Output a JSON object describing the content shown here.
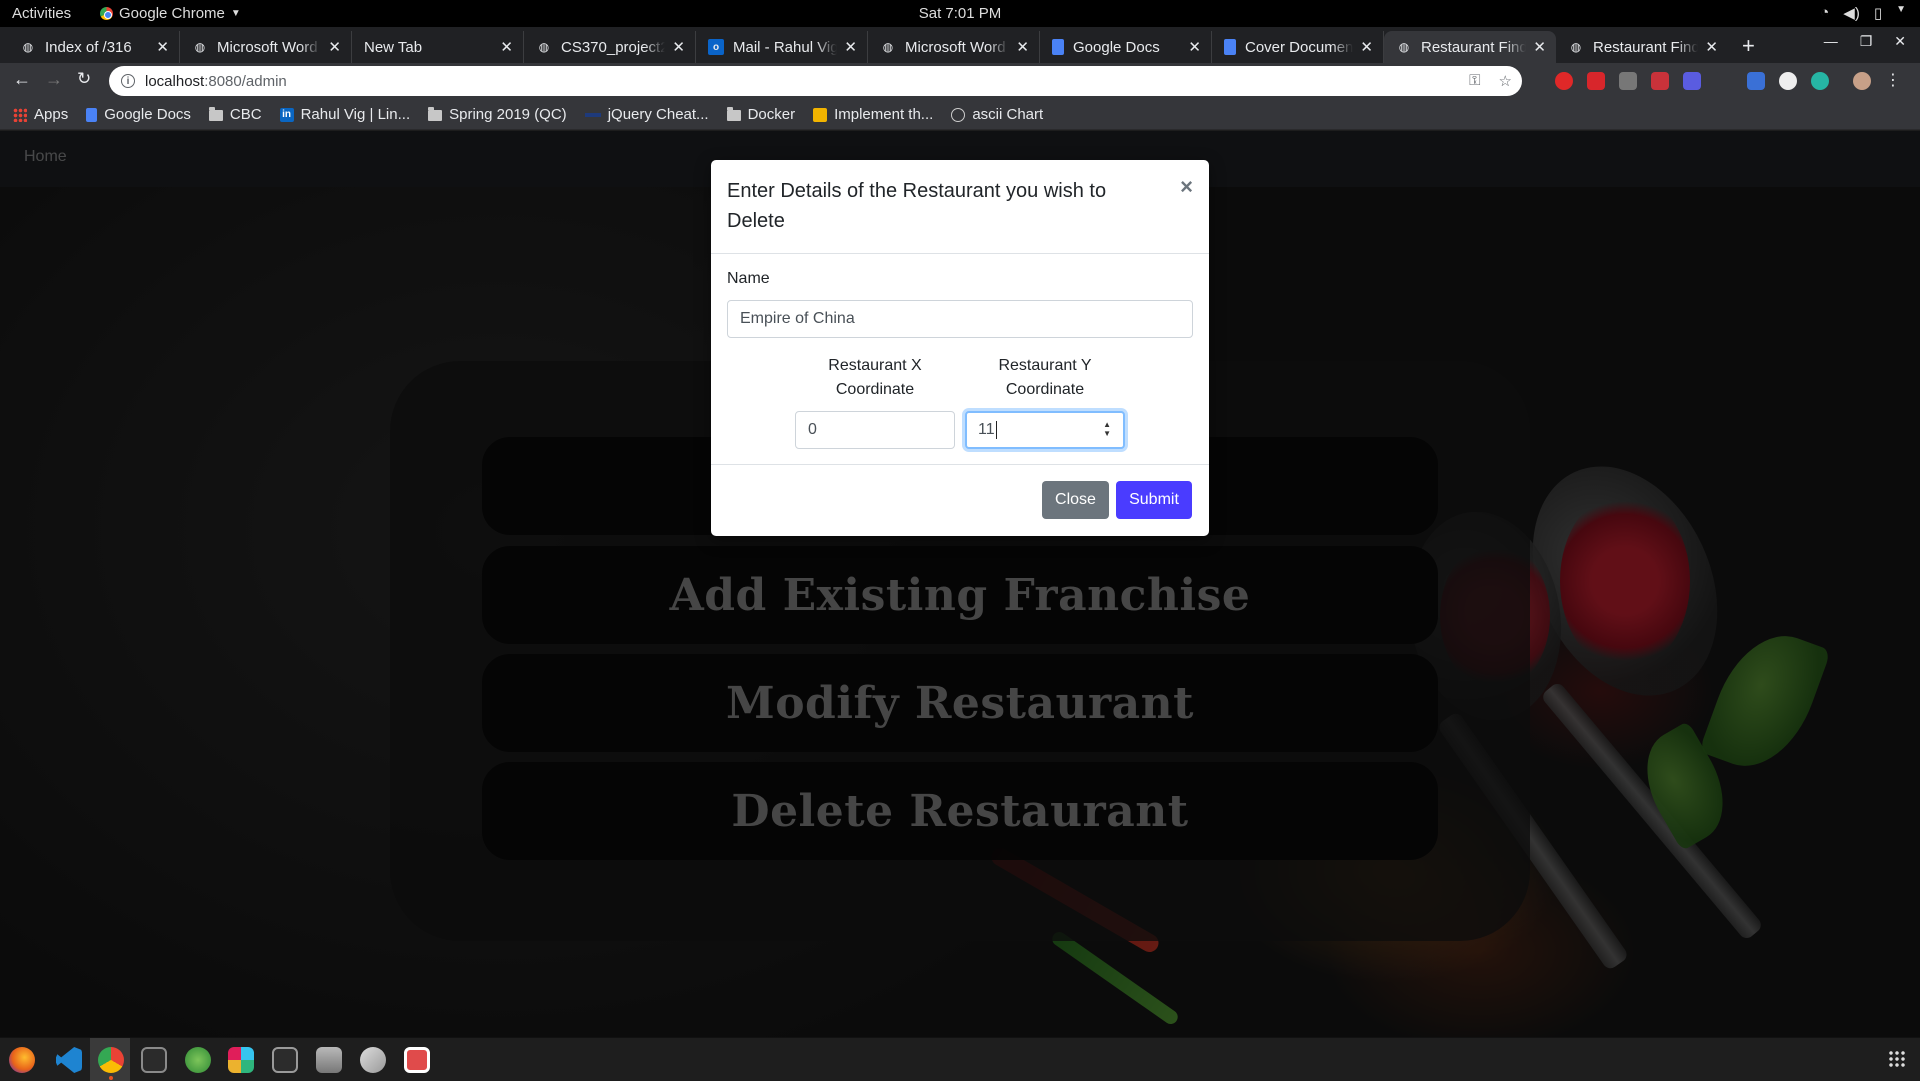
{
  "system_bar": {
    "activities": "Activities",
    "app_name": "Google Chrome",
    "clock": "Sat  7:01 PM"
  },
  "tabs": [
    {
      "title": "Index of /316",
      "active": false
    },
    {
      "title": "Microsoft Word",
      "active": false
    },
    {
      "title": "New Tab",
      "active": false
    },
    {
      "title": "CS370_project2",
      "active": false
    },
    {
      "title": "Mail - Rahul Vig",
      "active": false
    },
    {
      "title": "Microsoft Word",
      "active": false
    },
    {
      "title": "Google Docs",
      "active": false
    },
    {
      "title": "Cover Documen",
      "active": false
    },
    {
      "title": "Restaurant Find",
      "active": true
    },
    {
      "title": "Restaurant Find",
      "active": false
    }
  ],
  "address_bar": {
    "host": "localhost",
    "path": ":8080/admin"
  },
  "bookmarks": [
    {
      "label": "Apps",
      "icon": "apps-grid-icon"
    },
    {
      "label": "Google Docs",
      "icon": "docs-icon"
    },
    {
      "label": "CBC",
      "icon": "folder-icon"
    },
    {
      "label": "Rahul Vig | Lin...",
      "icon": "linkedin-icon"
    },
    {
      "label": "Spring 2019 (QC)",
      "icon": "folder-icon"
    },
    {
      "label": "jQuery Cheat...",
      "icon": "jquery-icon"
    },
    {
      "label": "Docker",
      "icon": "folder-icon"
    },
    {
      "label": "Implement th...",
      "icon": "bookmark-icon"
    },
    {
      "label": "ascii Chart",
      "icon": "globe-icon"
    }
  ],
  "page": {
    "nav_home": "Home",
    "menu_buttons": [
      "",
      "Add Existing Franchise",
      "Modify Restaurant",
      "Delete Restaurant"
    ]
  },
  "modal": {
    "title": "Enter Details of the Restaurant you wish to Delete",
    "close_symbol": "×",
    "name_label": "Name",
    "name_value": "Empire of China",
    "x_label": "Restaurant X Coordinate",
    "x_value": "0",
    "y_label": "Restaurant Y Coordinate",
    "y_value": "11",
    "close_button": "Close",
    "submit_button": "Submit"
  },
  "colors": {
    "submit": "#4a3cff",
    "close": "#6c757d",
    "focus_ring": "#80bdff"
  }
}
